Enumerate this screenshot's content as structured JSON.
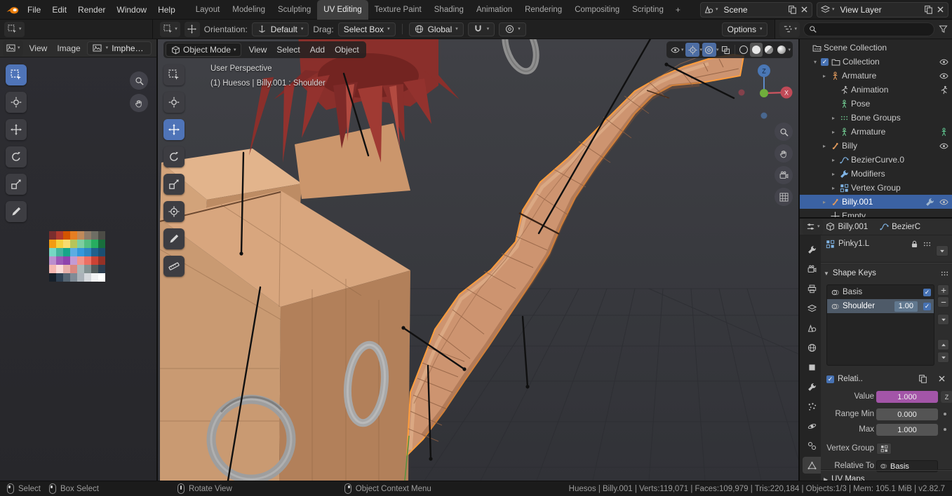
{
  "topbar": {
    "app_menus": [
      "File",
      "Edit",
      "Render",
      "Window",
      "Help"
    ],
    "workspaces": [
      "Layout",
      "Modeling",
      "Sculpting",
      "UV Editing",
      "Texture Paint",
      "Shading",
      "Animation",
      "Rendering",
      "Compositing",
      "Scripting"
    ],
    "active_workspace": "UV Editing",
    "new_workspace": "+",
    "scene_label": "Scene",
    "view_layer_label": "View Layer"
  },
  "tool_settings": {
    "orientation_label": "Orientation:",
    "orientation_value": "Default",
    "drag_label": "Drag:",
    "drag_value": "Select Box",
    "transform_orientation": "Global",
    "options_label": "Options"
  },
  "uv_editor": {
    "menus": [
      "View",
      "Image"
    ],
    "image_name": "ImphenziaPalet…",
    "tools": [
      {
        "name": "select-box",
        "active": true
      },
      {
        "name": "cursor"
      },
      {
        "name": "move"
      },
      {
        "name": "rotate"
      },
      {
        "name": "scale"
      },
      {
        "name": "annotate"
      }
    ],
    "palette": [
      [
        "#7a2e2e",
        "#b03a2e",
        "#d35400",
        "#e67e22",
        "#c08a5a",
        "#8d7b6a",
        "#6e6e64",
        "#4c4c46"
      ],
      [
        "#f39c12",
        "#f4d03f",
        "#f7dc6f",
        "#b7c55a",
        "#7dcea0",
        "#52be80",
        "#27ae60",
        "#196f3d"
      ],
      [
        "#76d7c4",
        "#45b39d",
        "#17a589",
        "#5dade2",
        "#3498db",
        "#2e86c1",
        "#21618c",
        "#1b4f72"
      ],
      [
        "#bb8fce",
        "#9b59b6",
        "#8e44ad",
        "#c39bd3",
        "#f1948a",
        "#ec7063",
        "#cb4335",
        "#943126"
      ],
      [
        "#f5b7b1",
        "#fadbd8",
        "#e6b0aa",
        "#d98880",
        "#aab7b8",
        "#839192",
        "#515a5a",
        "#2c3e50"
      ],
      [
        "#17202a",
        "#2e4053",
        "#566573",
        "#808b96",
        "#abb2b9",
        "#d5d8dc",
        "#f2f3f4",
        "#ffffff"
      ]
    ]
  },
  "viewport": {
    "mode": "Object Mode",
    "menus": [
      "View",
      "Select",
      "Add",
      "Object"
    ],
    "overlay_perspective": "User Perspective",
    "overlay_context": "(1) Huesos | Billy.001 : Shoulder",
    "tools": [
      {
        "name": "select-box"
      },
      {
        "name": "cursor"
      },
      {
        "name": "move",
        "active": true
      },
      {
        "name": "rotate"
      },
      {
        "name": "scale"
      },
      {
        "name": "transform"
      },
      {
        "name": "annotate"
      },
      {
        "name": "measure"
      }
    ],
    "gizmo": {
      "z_label": "Z",
      "x_label": "X"
    }
  },
  "outliner": {
    "rows": [
      {
        "label": "Scene Collection",
        "indent": 0,
        "icon": "scene-collection"
      },
      {
        "label": "Collection",
        "indent": 1,
        "icon": "collection",
        "disclosure": "open",
        "checkbox": true,
        "eye": true
      },
      {
        "label": "Armature",
        "indent": 2,
        "icon": "armature",
        "disclosure": "closed",
        "eye": true
      },
      {
        "label": "Animation",
        "indent": 3,
        "icon": "animation",
        "trail": "animation"
      },
      {
        "label": "Pose",
        "indent": 3,
        "icon": "pose"
      },
      {
        "label": "Bone Groups",
        "indent": 3,
        "icon": "bone-groups",
        "disclosure": "closed"
      },
      {
        "label": "Armature",
        "indent": 3,
        "icon": "armature-data",
        "disclosure": "closed",
        "trail": "armature-green"
      },
      {
        "label": "Billy",
        "indent": 2,
        "icon": "bone",
        "disclosure": "closed",
        "eye": true
      },
      {
        "label": "BezierCurve.0",
        "indent": 3,
        "icon": "curve",
        "disclosure": "closed"
      },
      {
        "label": "Modifiers",
        "indent": 3,
        "icon": "modifier",
        "disclosure": "closed"
      },
      {
        "label": "Vertex Group",
        "indent": 3,
        "icon": "vertex-group",
        "disclosure": "closed"
      },
      {
        "label": "Billy.001",
        "indent": 2,
        "icon": "bone",
        "disclosure": "closed",
        "selected": true,
        "wrench": true,
        "eye": true
      },
      {
        "label": "Empty",
        "indent": 2,
        "icon": "empty"
      }
    ]
  },
  "properties": {
    "breadcrumb_object": "Billy.001",
    "breadcrumb_data": "BezierC",
    "vertex_group_item": "Pinky1.L",
    "tabs": [
      "tool",
      "render",
      "output",
      "view-layer",
      "scene",
      "world",
      "object",
      "modifiers",
      "particles",
      "physics",
      "constraints",
      "object-data"
    ],
    "active_tab": "object-data",
    "shape_keys": {
      "title": "Shape Keys",
      "keys": [
        {
          "name": "Basis",
          "checked": true
        },
        {
          "name": "Shoulder",
          "value": "1.00",
          "checked": true,
          "selected": true
        }
      ],
      "relative_label": "Relati..",
      "value_label": "Value",
      "value": "1.000",
      "range_min_label": "Range Min",
      "range_min": "0.000",
      "max_label": "Max",
      "max": "1.000",
      "vertex_group_label": "Vertex Group",
      "relative_to_label": "Relative To",
      "relative_to_value": "Basis",
      "driver_badge": "Z"
    },
    "uv_maps_title": "UV Maps"
  },
  "statusbar": {
    "hints": [
      {
        "button": "left",
        "label": "Select"
      },
      {
        "button": "drag",
        "label": "Box Select"
      },
      {
        "button": "middle",
        "label": "Rotate View"
      },
      {
        "button": "right",
        "label": "Object Context Menu"
      }
    ],
    "stats": "Huesos | Billy.001 | Verts:119,071 | Faces:109,979 | Tris:220,184 | Objects:1/3 | Mem: 105.1 MiB | v2.82.7"
  },
  "colors": {
    "accent_blue": "#4772b3",
    "selection_orange": "#ff9d3c",
    "driver_purple": "#a355a8",
    "blender_orange": "#e87d0d"
  }
}
